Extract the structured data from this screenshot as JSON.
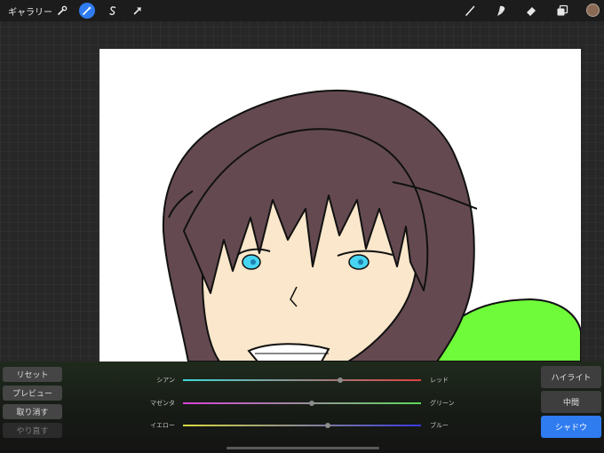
{
  "topbar": {
    "gallery_label": "ギャラリー",
    "left_icons": [
      "wrench-icon",
      "magic-wand-icon",
      "selection-icon",
      "transform-arrow-icon"
    ],
    "active_left_icon": "magic-wand-icon",
    "right_icons": [
      "brush-icon",
      "smudge-icon",
      "eraser-icon",
      "layers-icon"
    ],
    "current_color": "#8a6a55"
  },
  "left_buttons": {
    "reset": "リセット",
    "preview": "プレビュー",
    "undo": "取り消す",
    "redo": "やり直す"
  },
  "sliders": [
    {
      "left": "シアン",
      "right": "レッド",
      "left_color": "#3fd9d9",
      "right_color": "#e04040",
      "level": 0.66
    },
    {
      "left": "マゼンタ",
      "right": "グリーン",
      "left_color": "#d942d9",
      "right_color": "#5cd95c",
      "level": 0.54
    },
    {
      "left": "イエロー",
      "right": "ブルー",
      "left_color": "#d9d93f",
      "right_color": "#3a3ae0",
      "level": 0.61
    }
  ],
  "range_buttons": {
    "highlight": "ハイライト",
    "midtone": "中間",
    "shadow": "シャドウ",
    "selected": "shadow"
  },
  "accent_color": "#2f7bf0"
}
